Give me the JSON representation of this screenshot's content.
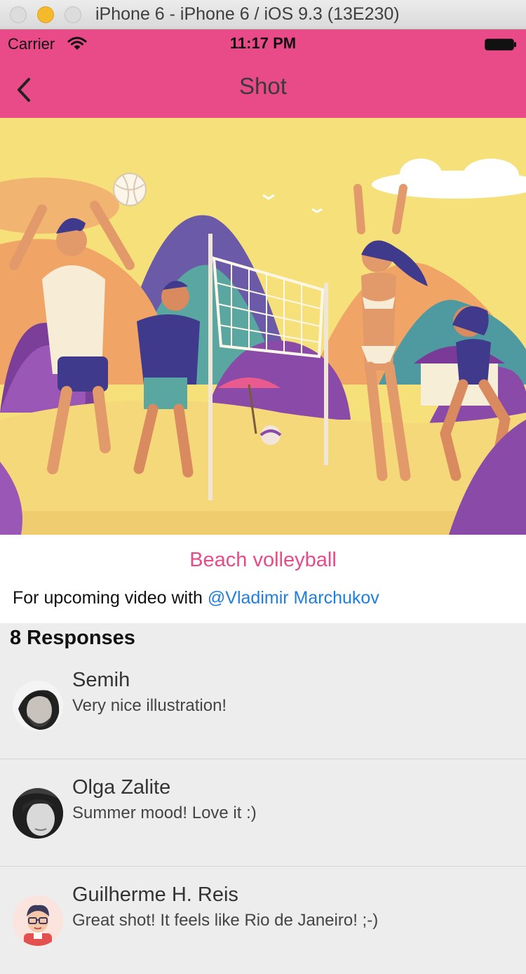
{
  "simulator": {
    "title": "iPhone 6 - iPhone 6 / iOS 9.3 (13E230)"
  },
  "status_bar": {
    "carrier": "Carrier",
    "time": "11:17 PM",
    "icons": [
      "wifi-icon",
      "battery-icon"
    ]
  },
  "nav": {
    "title": "Shot",
    "back_icon": "chevron-left-icon"
  },
  "colors": {
    "accent": "#e94b89",
    "link": "#1f7fe0",
    "background": "#ededed"
  },
  "shot": {
    "title": "Beach volleyball",
    "description_prefix": "For upcoming video with ",
    "mention": "@Vladimir Marchukov"
  },
  "responses": {
    "header": "8 Responses",
    "items": [
      {
        "name": "Semih",
        "text": "Very nice illustration!"
      },
      {
        "name": "Olga Zalite",
        "text": "Summer mood! Love it :)"
      },
      {
        "name": "Guilherme H. Reis",
        "text": "Great shot! It feels like Rio de Janeiro! ;-)"
      }
    ]
  }
}
